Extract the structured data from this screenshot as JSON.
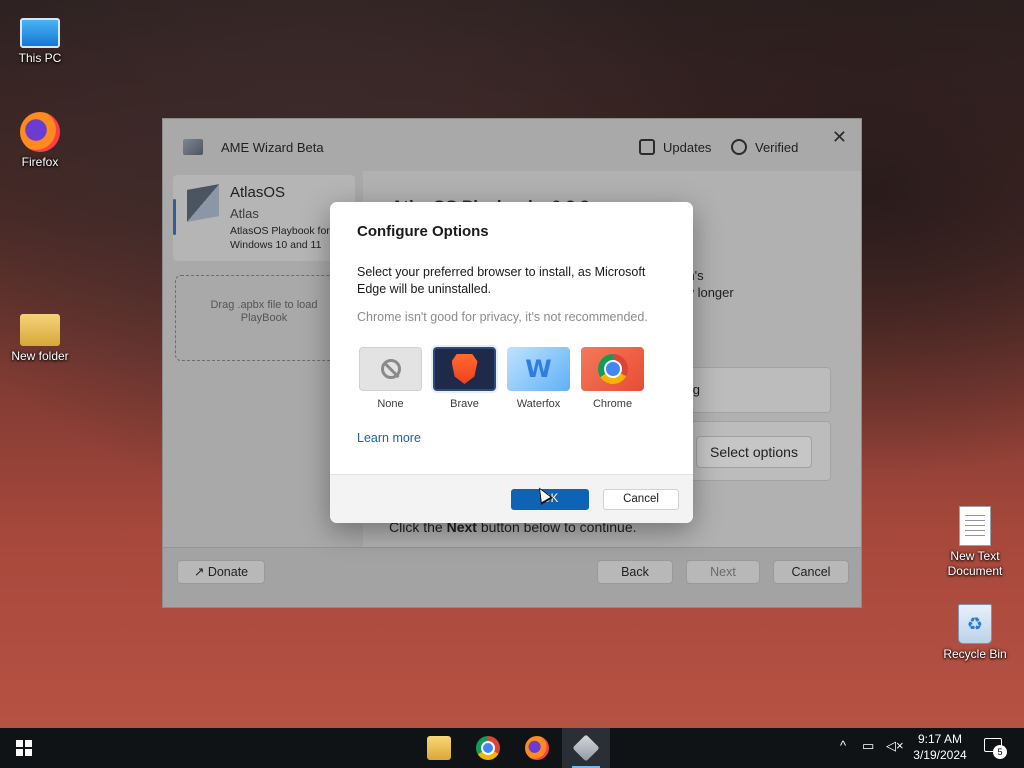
{
  "desktop": {
    "icons": [
      {
        "label": "This PC"
      },
      {
        "label": "Firefox"
      },
      {
        "label": "New folder"
      },
      {
        "label": "New Text Document"
      },
      {
        "label": "Recycle Bin"
      }
    ]
  },
  "wizard": {
    "title": "AME Wizard Beta",
    "updates_label": "Updates",
    "verified_label": "Verified",
    "close_glyph": "✕",
    "playbook": {
      "name": "AtlasOS",
      "author": "Atlas",
      "description": "AtlasOS Playbook for Windows 10 and 11"
    },
    "drop_zone": "Drag .apbx file to load PlayBook",
    "content": {
      "title": "AtlasOS Playbook v0.3.2",
      "text_line1": "tem's",
      "text_line2": "any longer",
      "row1_label": "g",
      "select_options": "Select options",
      "next_hint_pre": "Click the",
      "next_hint_bold": "Next",
      "next_hint_post": "button below to continue."
    },
    "footer": {
      "donate": "Donate",
      "back": "Back",
      "next": "Next",
      "cancel": "Cancel"
    }
  },
  "dialog": {
    "title": "Configure Options",
    "text": "Select your preferred browser to install, as Microsoft Edge will be uninstalled.",
    "note": "Chrome isn't good for privacy, it's not recommended.",
    "browsers": [
      {
        "label": "None",
        "selected": false
      },
      {
        "label": "Brave",
        "selected": true
      },
      {
        "label": "Waterfox",
        "selected": false
      },
      {
        "label": "Chrome",
        "selected": false
      }
    ],
    "learn_more": "Learn more",
    "ok": "OK",
    "cancel": "Cancel"
  },
  "taskbar": {
    "time": "9:17 AM",
    "date": "3/19/2024",
    "notification_count": "5",
    "tray_chevron": "^"
  }
}
